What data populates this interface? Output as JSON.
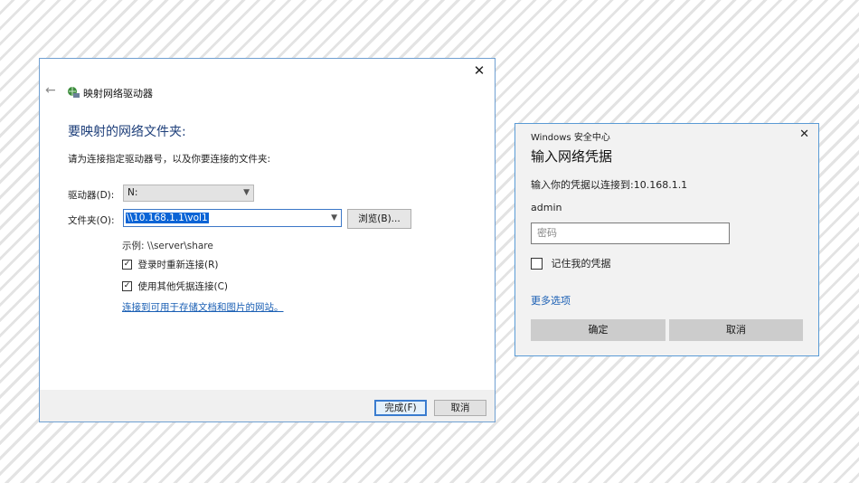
{
  "wizard": {
    "title": "映射网络驱动器",
    "heading": "要映射的网络文件夹:",
    "description": "请为连接指定驱动器号，以及你要连接的文件夹:",
    "drive_label": "驱动器(D):",
    "drive_value": "N:",
    "folder_label": "文件夹(O):",
    "folder_value": "\\\\10.168.1.1\\vol1",
    "browse_label": "浏览(B)...",
    "example": "示例: \\\\server\\share",
    "reconnect_label": "登录时重新连接(R)",
    "reconnect_checked": true,
    "other_creds_label": "使用其他凭据连接(C)",
    "other_creds_checked": true,
    "storage_link": "连接到可用于存储文档和图片的网站。",
    "finish_label": "完成(F)",
    "cancel_label": "取消",
    "close_glyph": "✕",
    "back_glyph": "←"
  },
  "security": {
    "app_title": "Windows 安全中心",
    "close_glyph": "✕",
    "heading": "输入网络凭据",
    "connect_text": "输入你的凭据以连接到:10.168.1.1",
    "username": "admin",
    "password_placeholder": "密码",
    "remember_label": "记住我的凭据",
    "remember_checked": false,
    "more_options": "更多选项",
    "ok_label": "确定",
    "cancel_label": "取消"
  },
  "colors": {
    "accent": "#3a7ccf",
    "link": "#1a5fb4",
    "heading_blue": "#1e3f7a"
  },
  "icons": [
    "network-drive-icon",
    "back-arrow-icon",
    "close-icon",
    "chevron-down-icon",
    "checkmark-icon"
  ]
}
